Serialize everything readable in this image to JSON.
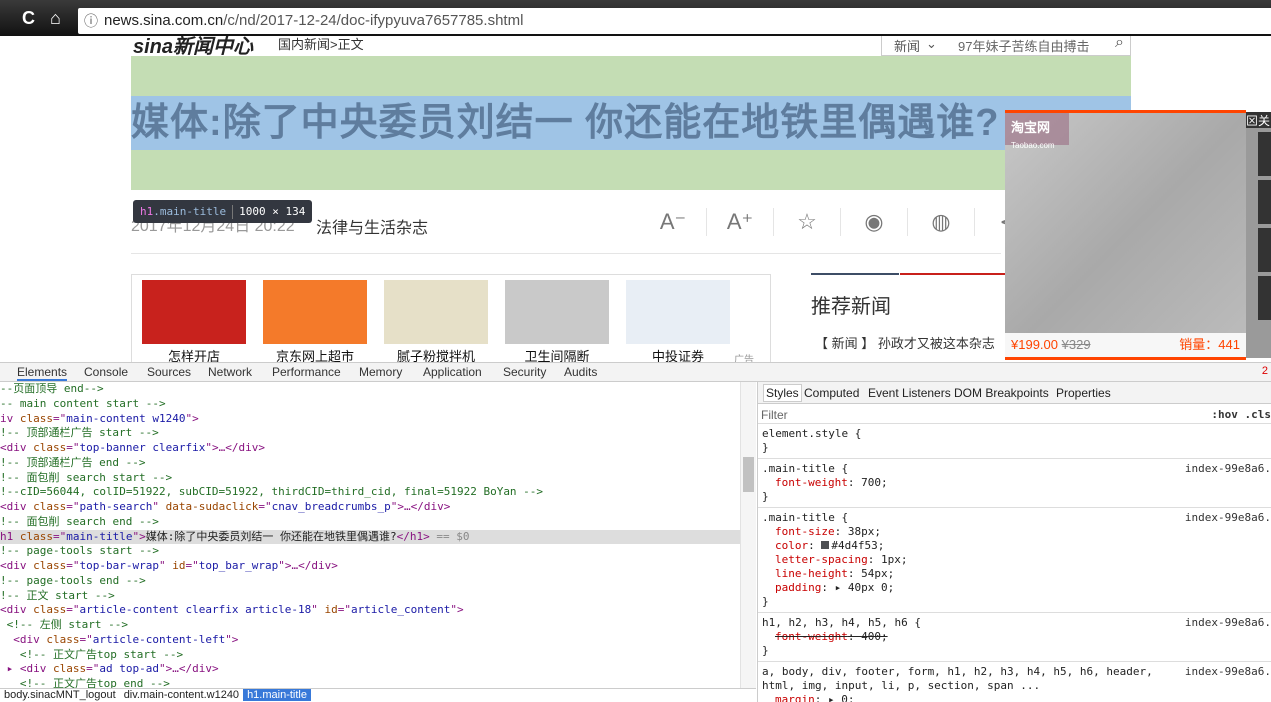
{
  "browser": {
    "url_host": "news.sina.com.cn",
    "url_path": "/c/nd/2017-12-24/doc-ifypyuva7657785.shtml",
    "back": "←",
    "reload": "C",
    "home": "⌂",
    "info": "ⓘ"
  },
  "page": {
    "logo": "sina新闻中心",
    "breadcrumb": "国内新闻>正文",
    "search_category": "新闻",
    "search_placeholder": "97年妹子苦练自由搏击",
    "title": "媒体:除了中央委员刘结一 你还能在地铁里偶遇谁?",
    "tooltip": {
      "selector_tag": "h1",
      "selector_class": ".main-title",
      "size": "1000 × 134"
    },
    "date": "2017年12月24日 20:22",
    "source": "法律与生活杂志",
    "tools": [
      "A⁻",
      "A⁺",
      "☆",
      "◉",
      "◍",
      "⋖"
    ],
    "ads": [
      {
        "label": "怎样开店",
        "color": "#c8221d"
      },
      {
        "label": "京东网上超市",
        "color": "#f47a2a"
      },
      {
        "label": "腻子粉搅拌机",
        "color": "#e6e0c8"
      },
      {
        "label": "卫生间隔断",
        "color": "#c9c9c9"
      },
      {
        "label": "中投证券",
        "color": "#e8eef5"
      }
    ],
    "ad_tag": "广告",
    "recommend_title": "推荐新闻",
    "recommend_item": "【 新闻 】 孙政才又被这本杂志",
    "float_ad": {
      "logo": "淘宝网",
      "logo_sub": "Taobao.com",
      "price": "¥199.00",
      "old_price": "¥329",
      "sales": "销量：441",
      "close": "⊠关"
    }
  },
  "devtools": {
    "tabs": [
      "Elements",
      "Console",
      "Sources",
      "Network",
      "Performance",
      "Memory",
      "Application",
      "Security",
      "Audits"
    ],
    "error_count": "2",
    "dom_lines": [
      [
        [
          "c",
          "--页面顶导 end-->"
        ]
      ],
      [
        [
          "c",
          "-- main content start -->"
        ]
      ],
      [
        [
          "tg",
          "iv "
        ],
        [
          "an",
          "class"
        ],
        [
          "tg",
          "=\""
        ],
        [
          "av",
          "main-content w1240"
        ],
        [
          "tg",
          "\">"
        ]
      ],
      [
        [
          "c",
          "!-- 顶部通栏广告 start -->"
        ]
      ],
      [
        [
          "tg",
          "<div "
        ],
        [
          "an",
          "class"
        ],
        [
          "tg",
          "=\""
        ],
        [
          "av",
          "top-banner clearfix"
        ],
        [
          "tg",
          "\">…</div>"
        ]
      ],
      [
        [
          "c",
          "!-- 顶部通栏广告 end -->"
        ]
      ],
      [
        [
          "c",
          "!-- 面包削 search start -->"
        ]
      ],
      [
        [
          "c",
          "!--cID=56044, colID=51922, subCID=51922, thirdCID=third_cid, final=51922 BoYan -->"
        ]
      ],
      [
        [
          "tg",
          "<div "
        ],
        [
          "an",
          "class"
        ],
        [
          "tg",
          "=\""
        ],
        [
          "av",
          "path-search"
        ],
        [
          "tg",
          "\" "
        ],
        [
          "an",
          "data-sudaclick"
        ],
        [
          "tg",
          "=\""
        ],
        [
          "av",
          "cnav_breadcrumbs_p"
        ],
        [
          "tg",
          "\">…</div>"
        ]
      ],
      [
        [
          "c",
          "!-- 面包削 search end -->"
        ]
      ],
      [
        [
          "tg",
          "h1 "
        ],
        [
          "an",
          "class"
        ],
        [
          "tg",
          "=\""
        ],
        [
          "av",
          "main-title"
        ],
        [
          "tg",
          "\">"
        ],
        [
          "tx",
          "媒体:除了中央委员刘结一 你还能在地铁里偶遇谁?"
        ],
        [
          "tg",
          "</h1>"
        ],
        [
          "eq",
          " == $0"
        ]
      ],
      [
        [
          "c",
          "!-- page-tools start -->"
        ]
      ],
      [
        [
          "tg",
          "<div "
        ],
        [
          "an",
          "class"
        ],
        [
          "tg",
          "=\""
        ],
        [
          "av",
          "top-bar-wrap"
        ],
        [
          "tg",
          "\" "
        ],
        [
          "an",
          "id"
        ],
        [
          "tg",
          "=\""
        ],
        [
          "av",
          "top_bar_wrap"
        ],
        [
          "tg",
          "\">…</div>"
        ]
      ],
      [
        [
          "c",
          "!-- page-tools end -->"
        ]
      ],
      [
        [
          "c",
          "!-- 正文 start -->"
        ]
      ],
      [
        [
          "tg",
          "<div "
        ],
        [
          "an",
          "class"
        ],
        [
          "tg",
          "=\""
        ],
        [
          "av",
          "article-content clearfix article-18"
        ],
        [
          "tg",
          "\" "
        ],
        [
          "an",
          "id"
        ],
        [
          "tg",
          "=\""
        ],
        [
          "av",
          "article_content"
        ],
        [
          "tg",
          "\">"
        ]
      ],
      [
        [
          "c",
          " <!-- 左侧 start -->"
        ]
      ],
      [
        [
          "tg",
          "  <div "
        ],
        [
          "an",
          "class"
        ],
        [
          "tg",
          "=\""
        ],
        [
          "av",
          "article-content-left"
        ],
        [
          "tg",
          "\">"
        ]
      ],
      [
        [
          "c",
          "   <!-- 正文广告top start -->"
        ]
      ],
      [
        [
          "tg",
          " ▸ <div "
        ],
        [
          "an",
          "class"
        ],
        [
          "tg",
          "=\""
        ],
        [
          "av",
          "ad top-ad"
        ],
        [
          "tg",
          "\">…</div>"
        ]
      ],
      [
        [
          "c",
          "   <!-- 正文广告top end -->"
        ]
      ]
    ],
    "selected_line": 10,
    "breadcrumbs": [
      "body.sinacMNT_logout",
      "div.main-content.w1240",
      "h1.main-title"
    ],
    "styles_tabs": [
      "Styles",
      "Computed",
      "Event Listeners",
      "DOM Breakpoints",
      "Properties"
    ],
    "filter": "Filter",
    "filter_right": ":hov .cls",
    "rules": [
      {
        "selector": "element.style {",
        "source": "",
        "props": []
      },
      {
        "selector": ".main-title {",
        "source": "index-99e8a6.",
        "props": [
          [
            "font-weight",
            "700"
          ]
        ]
      },
      {
        "selector": ".main-title {",
        "source": "index-99e8a6.",
        "props": [
          [
            "font-size",
            "38px"
          ],
          [
            "color",
            "#4d4f53"
          ],
          [
            "letter-spacing",
            "1px"
          ],
          [
            "line-height",
            "54px"
          ],
          [
            "padding",
            "▸ 40px 0"
          ]
        ]
      },
      {
        "selector": "h1, h2, h3, h4, h5, h6 {",
        "source": "index-99e8a6.",
        "props": [
          [
            "font-weight",
            "400"
          ]
        ],
        "struck": true
      },
      {
        "selector": "a, body, div, footer, form, h1, h2, h3, h4, h5, h6, header,\nhtml, img, input, li, p, section, span ...",
        "source": "index-99e8a6.",
        "props": [
          [
            "margin",
            "▸ 0"
          ]
        ]
      }
    ]
  }
}
